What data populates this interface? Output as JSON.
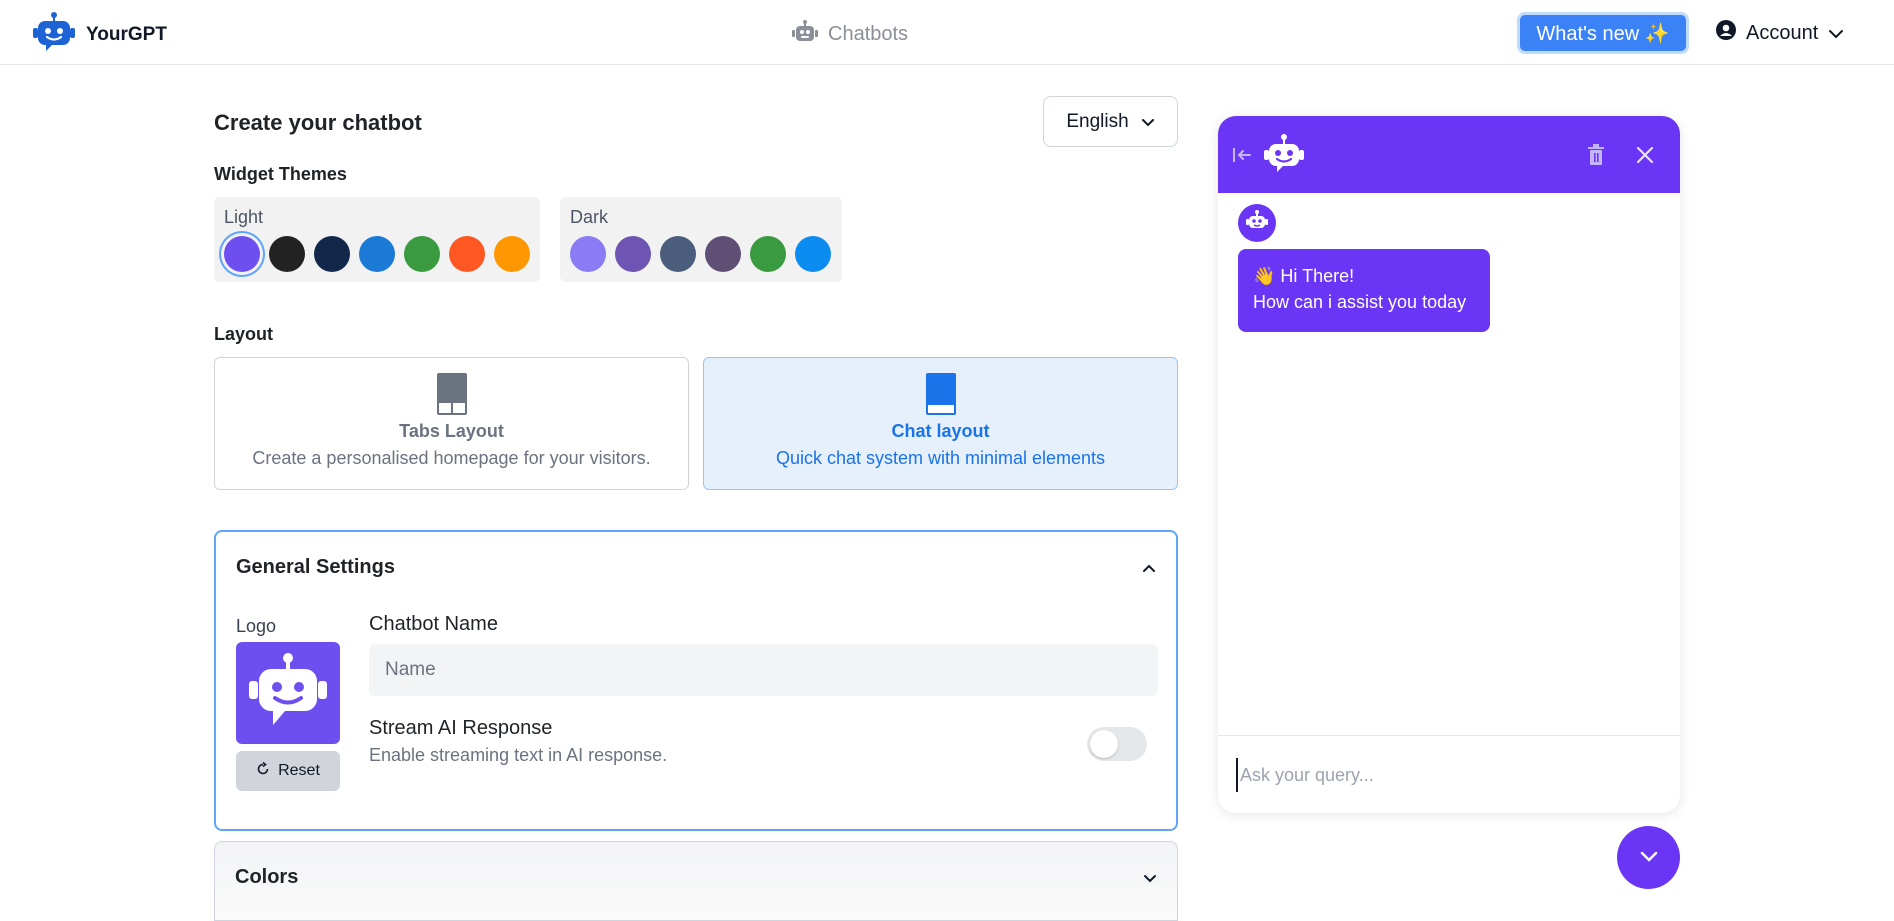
{
  "app": {
    "brand": "YourGPT"
  },
  "nav": {
    "center_label": "Chatbots",
    "whats_new": "What's new ✨",
    "account": "Account"
  },
  "page": {
    "title": "Create your chatbot",
    "language": "English"
  },
  "themes": {
    "label": "Widget Themes",
    "light": {
      "title": "Light",
      "colors": [
        "#6d4ff0",
        "#222222",
        "#12284b",
        "#1a7ad6",
        "#3a9a40",
        "#ff5722",
        "#ff9800"
      ],
      "selected_index": 0
    },
    "dark": {
      "title": "Dark",
      "colors": [
        "#8b7cf6",
        "#6e55b3",
        "#4a5d7a",
        "#5f4f74",
        "#3a9a40",
        "#0a8cf0"
      ]
    }
  },
  "layout": {
    "label": "Layout",
    "tabs": {
      "name": "Tabs Layout",
      "desc": "Create a personalised homepage for your visitors."
    },
    "chat": {
      "name": "Chat layout",
      "desc": "Quick chat system with minimal elements"
    },
    "selected": "chat"
  },
  "general": {
    "title": "General Settings",
    "logo_label": "Logo",
    "reset": "Reset",
    "chatbot_name_label": "Chatbot Name",
    "chatbot_name_placeholder": "Name",
    "chatbot_name_value": "",
    "stream_title": "Stream AI Response",
    "stream_desc": "Enable streaming text in AI response.",
    "stream_enabled": false
  },
  "colors_section": {
    "title": "Colors"
  },
  "chat_preview": {
    "greeting_line1": "👋 Hi There!",
    "greeting_line2": "How can i assist you today",
    "input_placeholder": "Ask your query...",
    "accent": "#6a35f5"
  }
}
